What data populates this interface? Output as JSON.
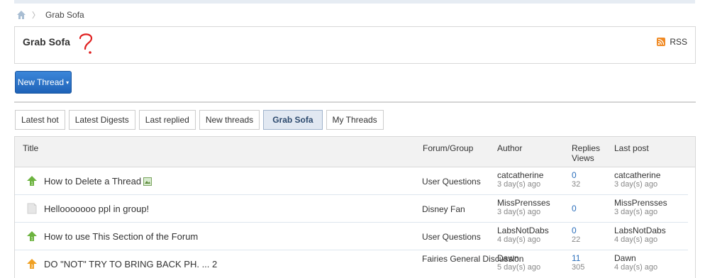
{
  "breadcrumb": {
    "current": "Grab Sofa",
    "separator": "〉"
  },
  "header": {
    "title": "Grab Sofa",
    "rss_label": "RSS"
  },
  "toolbar": {
    "new_thread_label": "New Thread",
    "new_thread_caret": "▾"
  },
  "tabs": [
    {
      "label": "Latest hot",
      "active": false
    },
    {
      "label": "Latest Digests",
      "active": false
    },
    {
      "label": "Last replied",
      "active": false
    },
    {
      "label": "New threads",
      "active": false
    },
    {
      "label": "Grab Sofa",
      "active": true
    },
    {
      "label": "My Threads",
      "active": false
    }
  ],
  "table": {
    "headers": {
      "title": "Title",
      "forum": "Forum/Group",
      "author": "Author",
      "replies": "Replies",
      "views": "Views",
      "last_post": "Last post"
    },
    "rows": [
      {
        "icon": "green-up-arrow-icon",
        "title": "How to Delete a Thread",
        "has_attachment": true,
        "forum": "User Questions",
        "author": "catcatherine",
        "author_time": "3 day(s) ago",
        "replies": "0",
        "views": "32",
        "last_author": "catcatherine",
        "last_time": "3 day(s) ago"
      },
      {
        "icon": "document-icon",
        "title": "Hellooooooo ppl in group!",
        "has_attachment": false,
        "forum": "Disney Fan",
        "author": "MissPrensses",
        "author_time": "3 day(s) ago",
        "replies": "0",
        "views": "",
        "last_author": "MissPrensses",
        "last_time": "3 day(s) ago"
      },
      {
        "icon": "green-up-arrow-icon",
        "title": "How to use This Section of the Forum",
        "has_attachment": false,
        "forum": "User Questions",
        "author": "LabsNotDabs",
        "author_time": "4 day(s) ago",
        "replies": "0",
        "views": "22",
        "last_author": "LabsNotDabs",
        "last_time": "4 day(s) ago"
      },
      {
        "icon": "orange-up-arrow-icon",
        "title": "DO \"NOT\" TRY TO BRING BACK PH. ... 2",
        "has_attachment": false,
        "forum": "Fairies General Discussion",
        "author": "Dawn",
        "author_time": "5 day(s) ago",
        "replies": "11",
        "views": "305",
        "last_author": "Dawn",
        "last_time": "4 day(s) ago"
      }
    ]
  },
  "colors": {
    "accent": "#2a6ebb",
    "button": "#1f63b8",
    "rss": "#f08a24",
    "annotation": "#e02020"
  }
}
